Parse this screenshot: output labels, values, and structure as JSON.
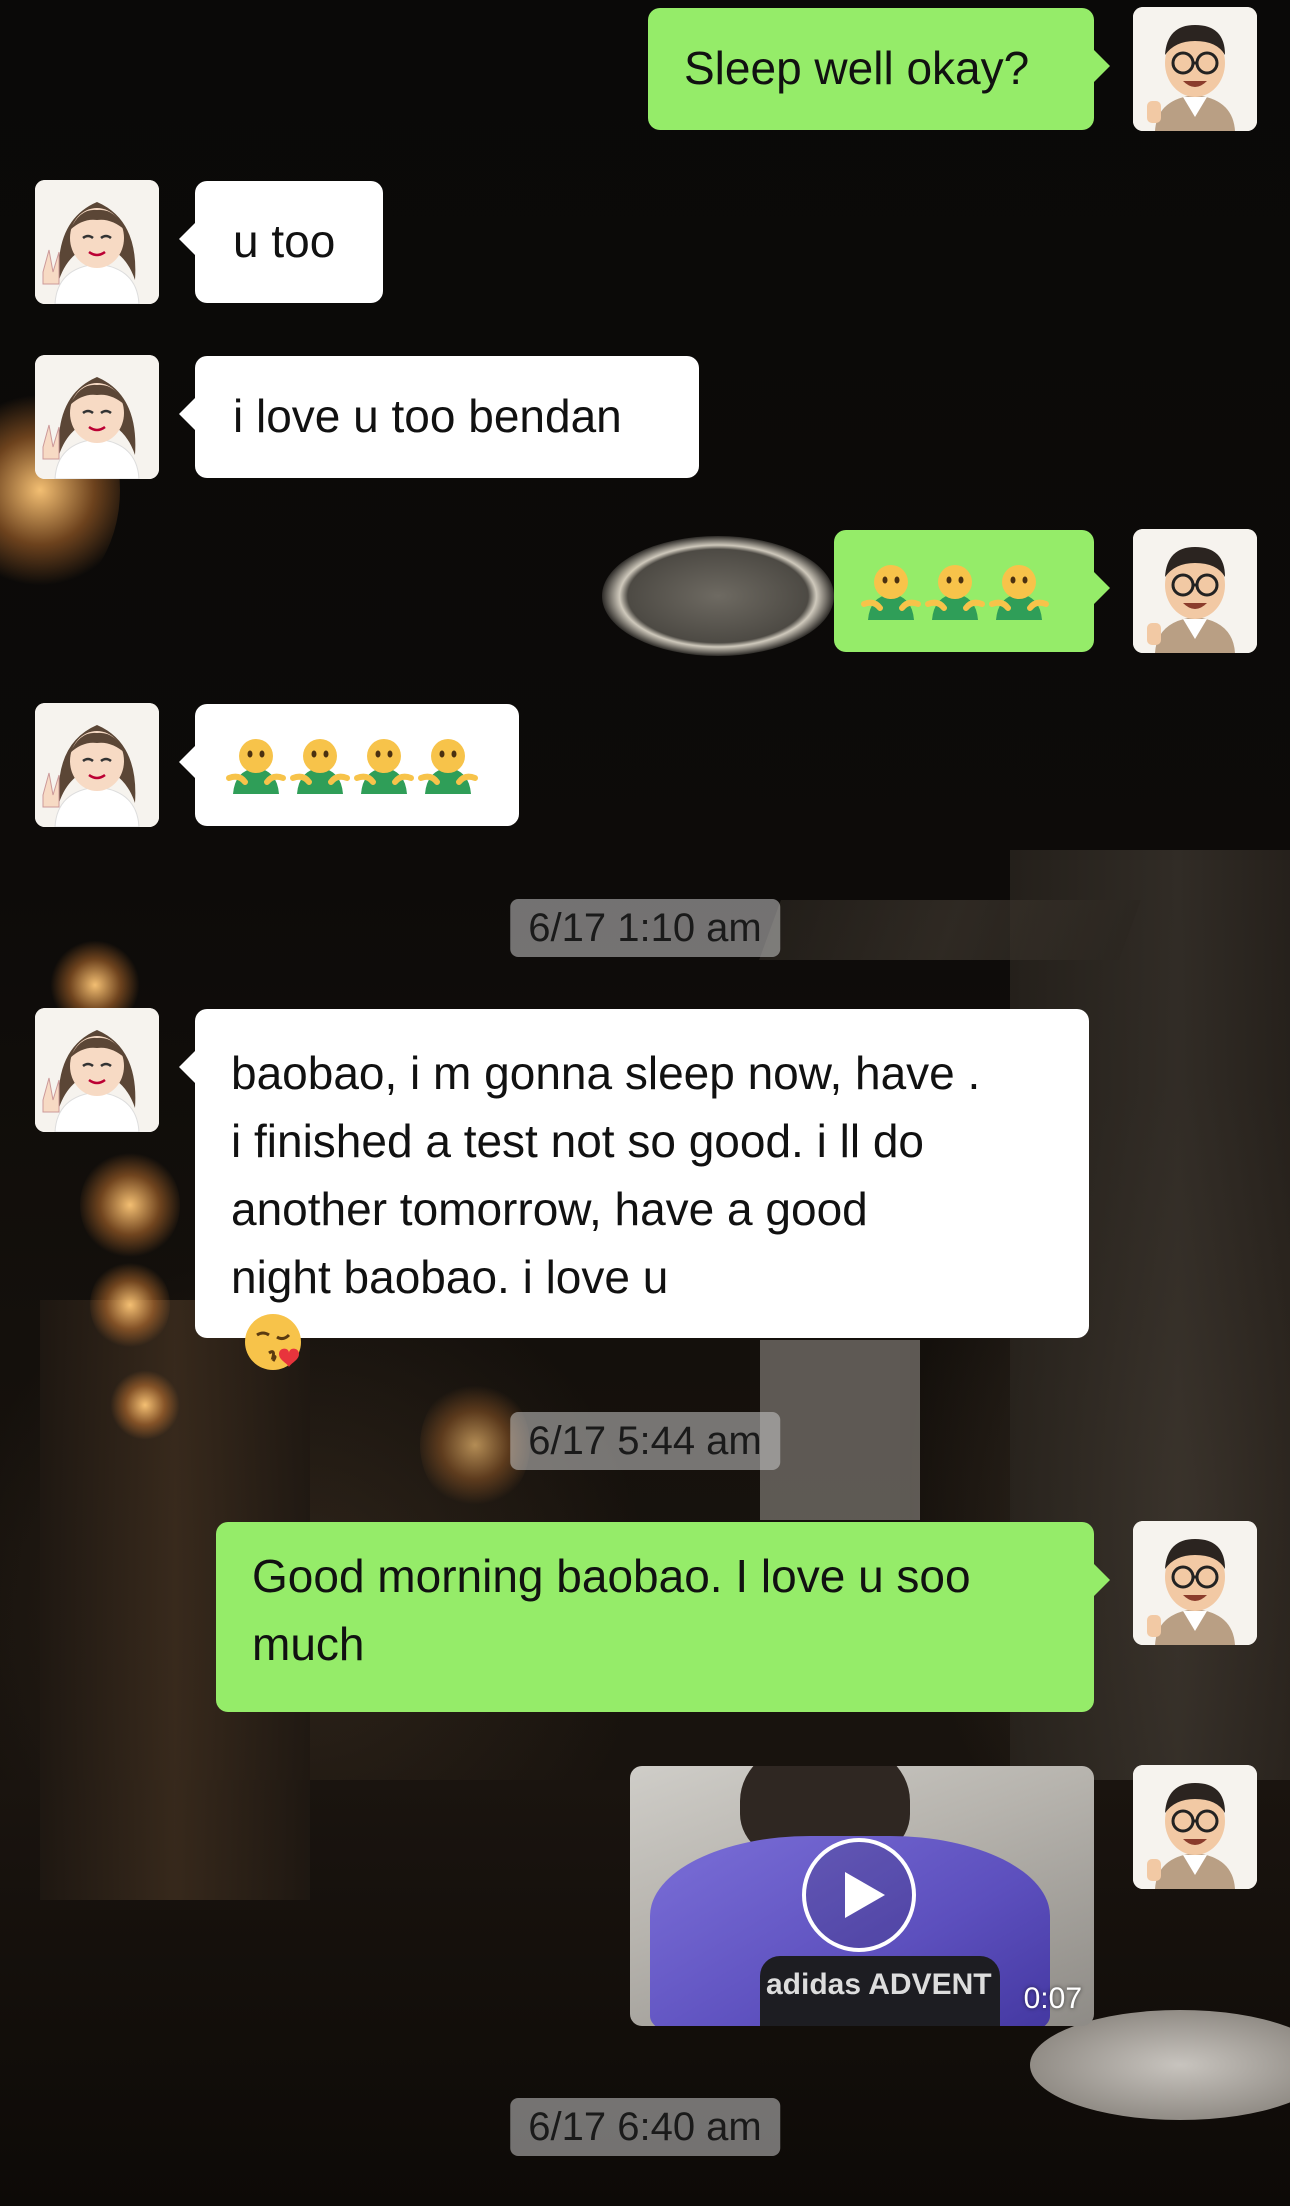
{
  "chat": {
    "messages": [
      {
        "sender": "me",
        "text": "Sleep well okay?"
      },
      {
        "sender": "her",
        "text": "u too"
      },
      {
        "sender": "her",
        "text": "i love u too bendan"
      },
      {
        "sender": "me",
        "emoji_count": 3,
        "emoji": "hugging-person-green-shirt"
      },
      {
        "sender": "her",
        "emoji_count": 4,
        "emoji": "hugging-person-green-shirt"
      },
      {
        "type": "timestamp",
        "text": "6/17 1:10 am"
      },
      {
        "sender": "her",
        "text": "baobao, i m gonna sleep now, have .\ni finished a test not so good. i ll do\nanother tomorrow, have a good\nnight baobao. i love u",
        "trailing_emoji": "kissing-face-heart"
      },
      {
        "type": "timestamp",
        "text": "6/17 5:44 am"
      },
      {
        "sender": "me",
        "text": "Good morning baobao. I love u soo\nmuch"
      },
      {
        "sender": "me",
        "type": "video",
        "duration": "0:07",
        "thumbnail_text": "adidas ADVENT"
      },
      {
        "type": "timestamp",
        "text": "6/17 6:40 am"
      }
    ]
  },
  "colors": {
    "outgoing_bubble": "#95ec69",
    "incoming_bubble": "#ffffff",
    "timestamp_bg": "rgba(200,200,200,.55)"
  }
}
